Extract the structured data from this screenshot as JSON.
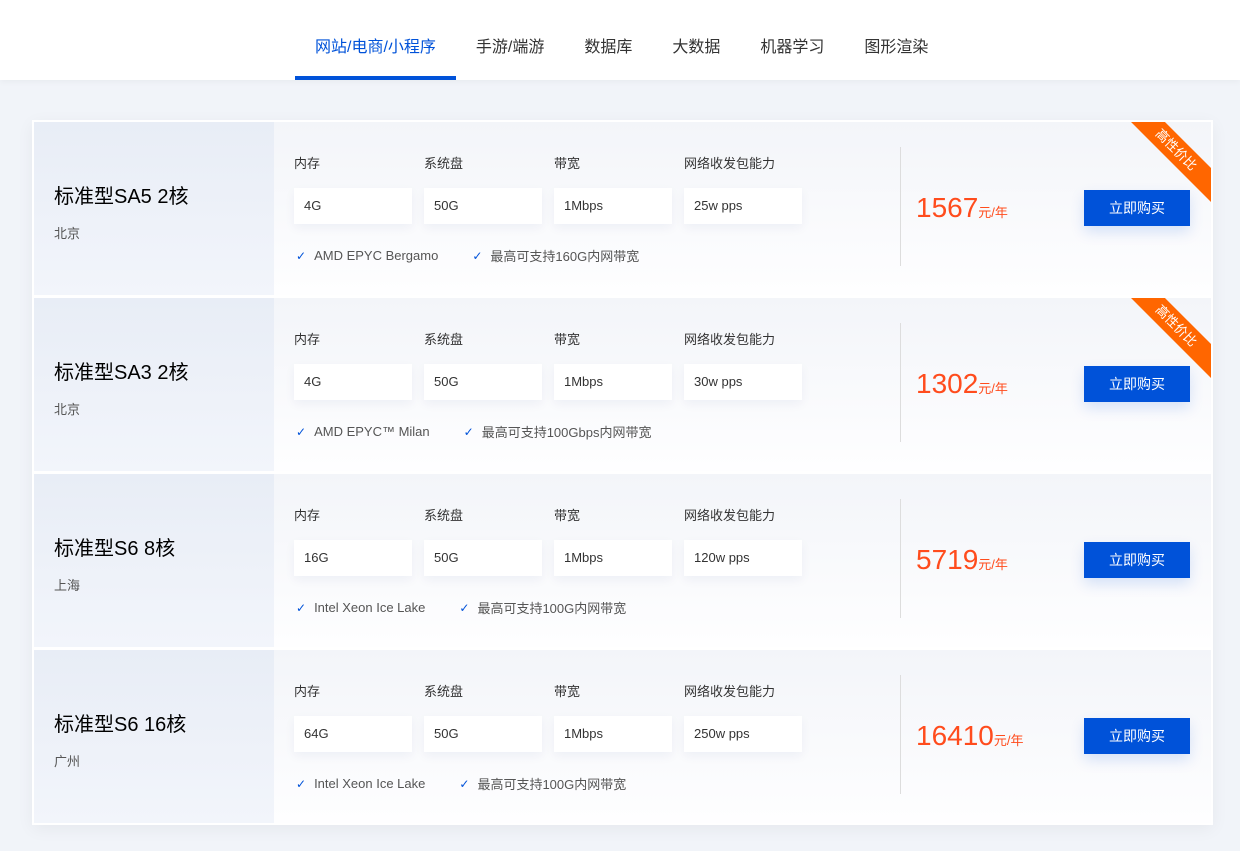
{
  "tabs": [
    {
      "label": "网站/电商/小程序",
      "active": true
    },
    {
      "label": "手游/端游"
    },
    {
      "label": "数据库"
    },
    {
      "label": "大数据"
    },
    {
      "label": "机器学习"
    },
    {
      "label": "图形渲染"
    }
  ],
  "spec_labels": [
    "内存",
    "系统盘",
    "带宽",
    "网络收发包能力"
  ],
  "buy_label": "立即购买",
  "unit": "元/年",
  "colors": {
    "accent": "#0052d9",
    "price": "#ff4c1d",
    "ribbon": "#ff6600"
  },
  "products": [
    {
      "name": "标准型SA5 2核",
      "region": "北京",
      "specs": [
        "4G",
        "50G",
        "1Mbps",
        "25w pps"
      ],
      "features": [
        "AMD EPYC Bergamo",
        "最高可支持160G内网带宽"
      ],
      "price": "1567",
      "ribbon": "高性价比"
    },
    {
      "name": "标准型SA3 2核",
      "region": "北京",
      "specs": [
        "4G",
        "50G",
        "1Mbps",
        "30w pps"
      ],
      "features": [
        "AMD EPYC™ Milan",
        "最高可支持100Gbps内网带宽"
      ],
      "price": "1302",
      "ribbon": "高性价比"
    },
    {
      "name": "标准型S6 8核",
      "region": "上海",
      "specs": [
        "16G",
        "50G",
        "1Mbps",
        "120w pps"
      ],
      "features": [
        "Intel Xeon Ice Lake",
        "最高可支持100G内网带宽"
      ],
      "price": "5719"
    },
    {
      "name": "标准型S6 16核",
      "region": "广州",
      "specs": [
        "64G",
        "50G",
        "1Mbps",
        "250w pps"
      ],
      "features": [
        "Intel Xeon Ice Lake",
        "最高可支持100G内网带宽"
      ],
      "price": "16410"
    }
  ]
}
